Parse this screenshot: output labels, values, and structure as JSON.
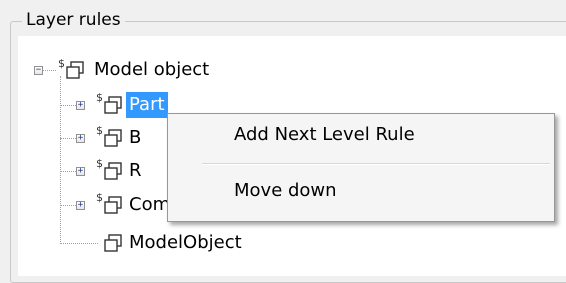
{
  "group": {
    "title": "Layer rules"
  },
  "tree": {
    "root_label": "Model object",
    "items": [
      {
        "label": "Part"
      },
      {
        "label": "B"
      },
      {
        "label": "R"
      },
      {
        "label": "Component"
      },
      {
        "label": "ModelObject"
      }
    ],
    "rule_marker": "$"
  },
  "context_menu": {
    "items": [
      {
        "label": "Add Next Level Rule"
      },
      {
        "label": "Move down"
      }
    ]
  }
}
